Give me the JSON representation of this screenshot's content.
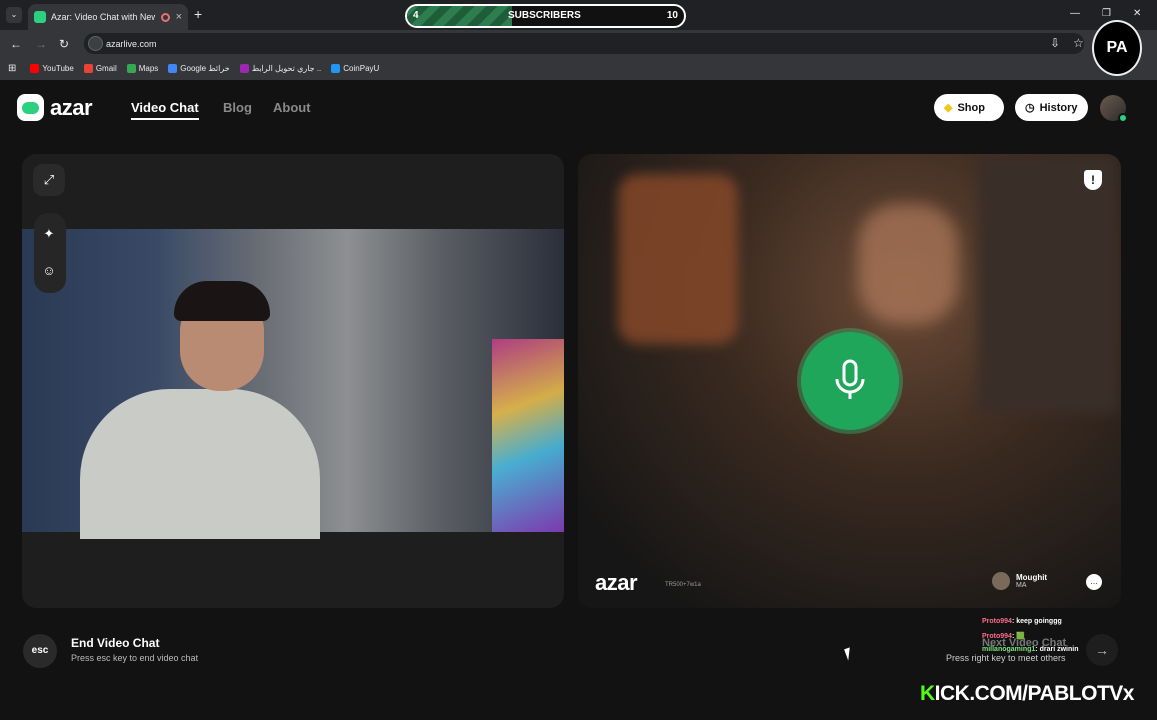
{
  "browser": {
    "tab_title": "Azar: Video Chat with New",
    "tab_close": "×",
    "new_tab": "+",
    "url": "azarlive.com",
    "bookmarks": [
      {
        "label": "YouTube",
        "color": "#ff0000"
      },
      {
        "label": "Gmail",
        "color": "#ea4335"
      },
      {
        "label": "Maps",
        "color": "#34a853"
      },
      {
        "label": "Google خرائط",
        "color": "#4285f4"
      },
      {
        "label": "جاري تحويل الرابط ..",
        "color": "#9c27b0"
      },
      {
        "label": "CoinPayU",
        "color": "#2196f3"
      }
    ]
  },
  "overlay": {
    "subscribers_label": "SUBSCRIBERS",
    "subscribers_start": "4",
    "subscribers_goal": "10",
    "subscribers_progress": 0.38,
    "corner_logo": "PA",
    "kick_prefix": "K",
    "kick_rest": "ICK.COM/PABLOTVx",
    "chat": [
      {
        "user": "Proto994",
        "text": ": keep goinggg"
      },
      {
        "user": "Proto994",
        "text": ": 🟩"
      },
      {
        "user": "millanogaming1",
        "text": ": drari zwinin"
      }
    ]
  },
  "app": {
    "brand": "azar",
    "nav": [
      {
        "label": "Video Chat",
        "active": true
      },
      {
        "label": "Blog",
        "active": false
      },
      {
        "label": "About",
        "active": false
      }
    ],
    "shop_label": "Shop",
    "history_label": "History",
    "accent": "#2bd17e",
    "partner": {
      "name": "Moughit",
      "country": "MA",
      "id": "TR500+7w1a"
    },
    "end": {
      "key": "esc",
      "title": "End Video Chat",
      "hint": "Press esc key to end video chat"
    },
    "next": {
      "title": "Next Video Chat",
      "hint": "Press right key to meet others"
    }
  }
}
